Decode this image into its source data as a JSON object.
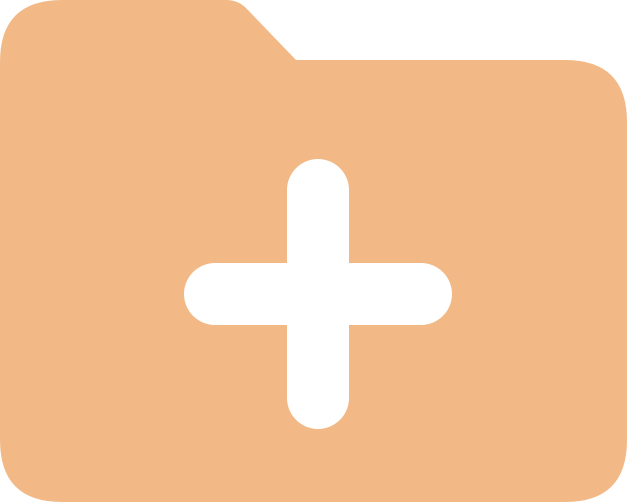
{
  "icon": {
    "name": "folder-add-icon",
    "folder_color": "#F2B986",
    "plus_color": "#FFFFFF"
  }
}
